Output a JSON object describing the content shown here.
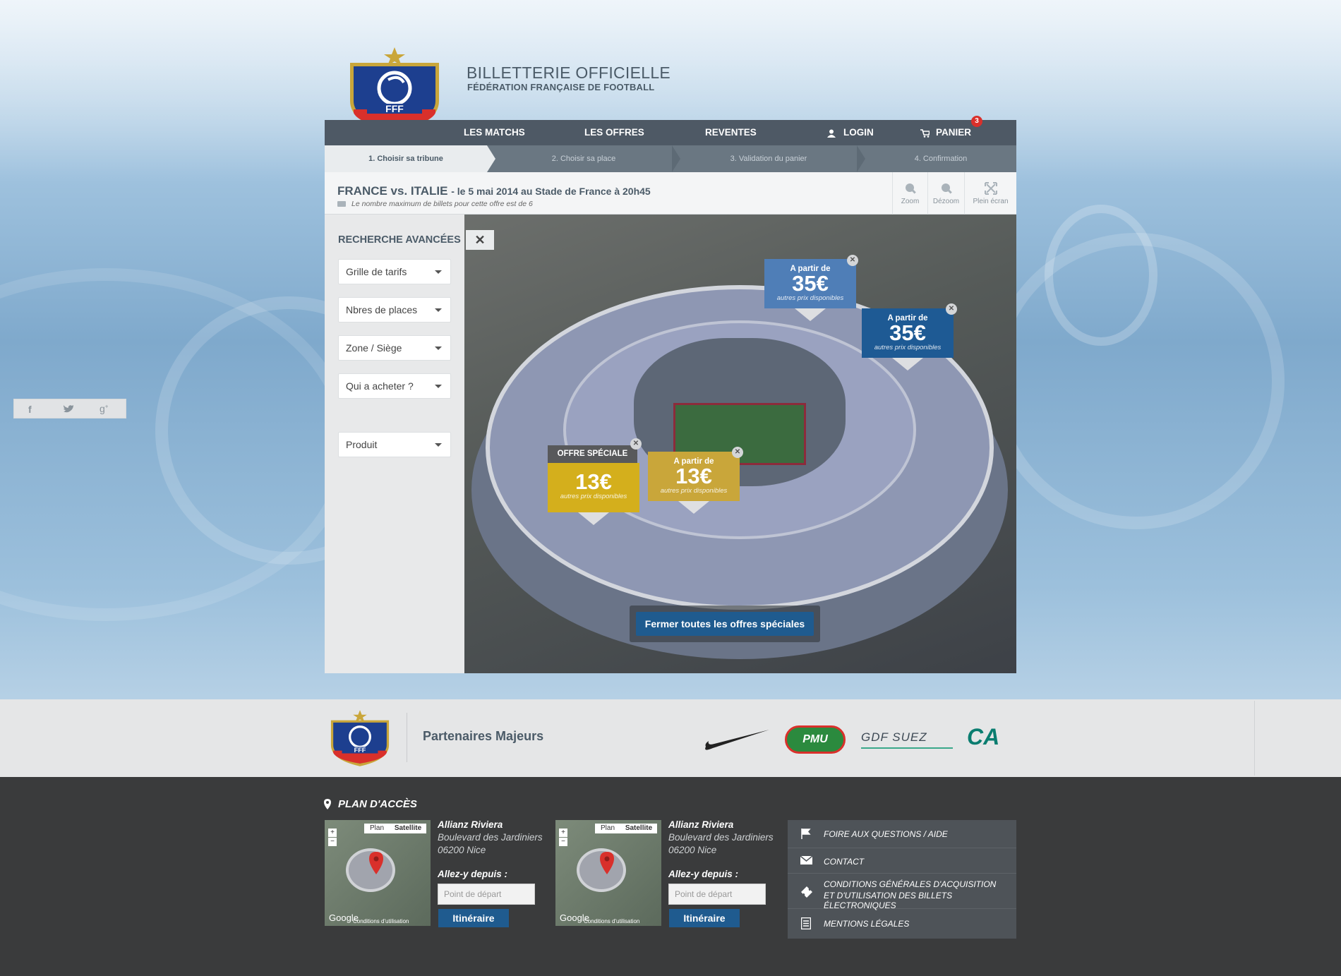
{
  "brand": {
    "title": "BILLETTERIE OFFICIELLE",
    "subtitle": "FÉDÉRATION FRANÇAISE DE FOOTBALL",
    "logo_text": "FFF"
  },
  "nav": {
    "matches": "LES MATCHS",
    "offers": "LES OFFRES",
    "resales": "REVENTES",
    "login": "LOGIN",
    "cart": "PANIER",
    "cart_count": "3"
  },
  "steps": [
    "1. Choisir sa tribune",
    "2. Choisir sa place",
    "3. Validation du panier",
    "4. Confirmation"
  ],
  "match": {
    "title": "FRANCE vs. ITALIE",
    "details": "- le 5 mai 2014 au Stade de France à 20h45",
    "note": "Le nombre maximum de billets pour cette offre est de 6"
  },
  "tools": {
    "zoom": "Zoom",
    "unzoom": "Dézoom",
    "fullscreen": "Plein écran"
  },
  "sidebar": {
    "title": "RECHERCHE AVANCÉES",
    "filters": [
      "Grille de tarifs",
      "Nbres de places",
      "Zone / Siège",
      "Qui a acheter ?",
      "Produit"
    ]
  },
  "map": {
    "close": "✕",
    "special_label": "OFFRE SPÉCIALE",
    "from_label": "A partir de",
    "alt_prices": "autres prix disponibles",
    "offers": [
      {
        "price": "35€",
        "color": "#4f7eb7"
      },
      {
        "price": "35€",
        "color": "#1e5a94"
      },
      {
        "price": "13€",
        "color": "#c9a63a"
      },
      {
        "price": "13€",
        "color": "#d4af1c"
      }
    ],
    "close_all": "Fermer toutes les offres spéciales"
  },
  "partners": {
    "title": "Partenaires Majeurs",
    "pmu": "PMU",
    "gdf": "GDF SUEZ",
    "ca": "CA"
  },
  "access": {
    "title": "PLAN D'ACCÈS",
    "map_plan": "Plan",
    "map_satellite": "Satellite",
    "map_google": "Google",
    "map_terms": "Conditions d'utilisation",
    "venue": "Allianz Riviera",
    "street": "Boulevard des Jardiniers",
    "city": "06200 Nice",
    "from": "Allez-y depuis :",
    "placeholder": "Point de départ",
    "itinerary": "Itinéraire"
  },
  "footer_links": [
    "FOIRE AUX QUESTIONS / AIDE",
    "CONTACT",
    "CONDITIONS GÉNÉRALES D'ACQUISITION",
    "ET D'UTILISATION DES BILLETS ÉLECTRONIQUES",
    "MENTIONS LÉGALES"
  ],
  "colors": {
    "nav": "#4e5965",
    "accent_blue": "#1f5b8f",
    "badge": "#d9302b",
    "footer": "#3a3b3c"
  }
}
